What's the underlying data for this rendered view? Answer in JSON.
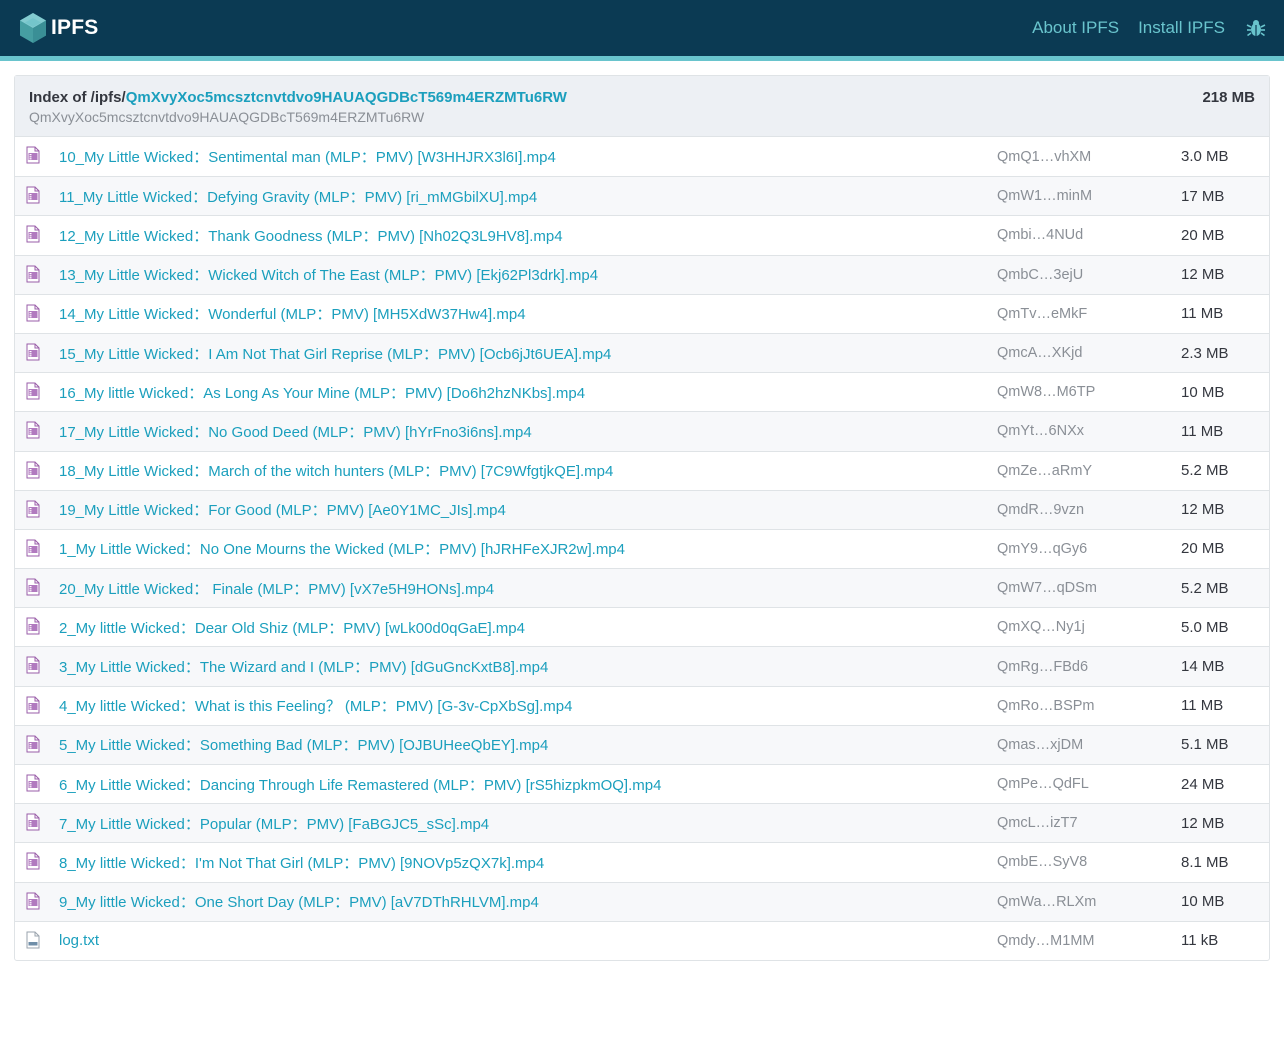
{
  "brand": {
    "name": "IPFS"
  },
  "nav": {
    "about": "About IPFS",
    "install": "Install IPFS"
  },
  "index": {
    "prefix": "Index of /ipfs/",
    "cid": "QmXvyXoc5mcsztcnvtdvo9HAUAQGDBcT569m4ERZMTu6RW",
    "cid_sub": "QmXvyXoc5mcsztcnvtdvo9HAUAQGDBcT569m4ERZMTu6RW",
    "total_size": "218 MB"
  },
  "files": [
    {
      "name": "10_My Little Wicked：Sentimental man (MLP：PMV) [W3HHJRX3l6I].mp4",
      "hash": "QmQ1…vhXM",
      "size": "3.0 MB",
      "type": "video"
    },
    {
      "name": "11_My Little Wicked：Defying Gravity (MLP：PMV) [ri_mMGbilXU].mp4",
      "hash": "QmW1…minM",
      "size": "17 MB",
      "type": "video"
    },
    {
      "name": "12_My Little Wicked：Thank Goodness (MLP：PMV) [Nh02Q3L9HV8].mp4",
      "hash": "Qmbi…4NUd",
      "size": "20 MB",
      "type": "video"
    },
    {
      "name": "13_My Little Wicked：Wicked Witch of The East (MLP：PMV) [Ekj62Pl3drk].mp4",
      "hash": "QmbC…3ejU",
      "size": "12 MB",
      "type": "video"
    },
    {
      "name": "14_My Little Wicked：Wonderful (MLP：PMV) [MH5XdW37Hw4].mp4",
      "hash": "QmTv…eMkF",
      "size": "11 MB",
      "type": "video"
    },
    {
      "name": "15_My Little Wicked：I Am Not That Girl Reprise (MLP：PMV) [Ocb6jJt6UEA].mp4",
      "hash": "QmcA…XKjd",
      "size": "2.3 MB",
      "type": "video"
    },
    {
      "name": "16_My little Wicked：As Long As Your Mine (MLP：PMV) [Do6h2hzNKbs].mp4",
      "hash": "QmW8…M6TP",
      "size": "10 MB",
      "type": "video"
    },
    {
      "name": "17_My Little Wicked：No Good Deed (MLP：PMV) [hYrFno3i6ns].mp4",
      "hash": "QmYt…6NXx",
      "size": "11 MB",
      "type": "video"
    },
    {
      "name": "18_My Little Wicked：March of the witch hunters (MLP：PMV) [7C9WfgtjkQE].mp4",
      "hash": "QmZe…aRmY",
      "size": "5.2 MB",
      "type": "video"
    },
    {
      "name": "19_My Little Wicked：For Good (MLP：PMV) [Ae0Y1MC_JIs].mp4",
      "hash": "QmdR…9vzn",
      "size": "12 MB",
      "type": "video"
    },
    {
      "name": "1_My Little Wicked：No One Mourns the Wicked (MLP：PMV) [hJRHFeXJR2w].mp4",
      "hash": "QmY9…qGy6",
      "size": "20 MB",
      "type": "video"
    },
    {
      "name": "20_My Little Wicked： Finale (MLP：PMV) [vX7e5H9HONs].mp4",
      "hash": "QmW7…qDSm",
      "size": "5.2 MB",
      "type": "video"
    },
    {
      "name": "2_My little Wicked：Dear Old Shiz (MLP：PMV) [wLk00d0qGaE].mp4",
      "hash": "QmXQ…Ny1j",
      "size": "5.0 MB",
      "type": "video"
    },
    {
      "name": "3_My Little Wicked：The Wizard and I (MLP：PMV) [dGuGncKxtB8].mp4",
      "hash": "QmRg…FBd6",
      "size": "14 MB",
      "type": "video"
    },
    {
      "name": "4_My little Wicked：What is this Feeling？ (MLP：PMV) [G-3v-CpXbSg].mp4",
      "hash": "QmRo…BSPm",
      "size": "11 MB",
      "type": "video"
    },
    {
      "name": "5_My Little Wicked：Something Bad (MLP：PMV) [OJBUHeeQbEY].mp4",
      "hash": "Qmas…xjDM",
      "size": "5.1 MB",
      "type": "video"
    },
    {
      "name": "6_My Little Wicked：Dancing Through Life Remastered (MLP：PMV) [rS5hizpkmOQ].mp4",
      "hash": "QmPe…QdFL",
      "size": "24 MB",
      "type": "video"
    },
    {
      "name": "7_My Little Wicked：Popular (MLP：PMV) [FaBGJC5_sSc].mp4",
      "hash": "QmcL…izT7",
      "size": "12 MB",
      "type": "video"
    },
    {
      "name": "8_My little Wicked：I'm Not That Girl (MLP：PMV) [9NOVp5zQX7k].mp4",
      "hash": "QmbE…SyV8",
      "size": "8.1 MB",
      "type": "video"
    },
    {
      "name": "9_My little Wicked：One Short Day (MLP：PMV) [aV7DThRHLVM].mp4",
      "hash": "QmWa…RLXm",
      "size": "10 MB",
      "type": "video"
    },
    {
      "name": "log.txt",
      "hash": "Qmdy…M1MM",
      "size": "11 kB",
      "type": "text"
    }
  ]
}
